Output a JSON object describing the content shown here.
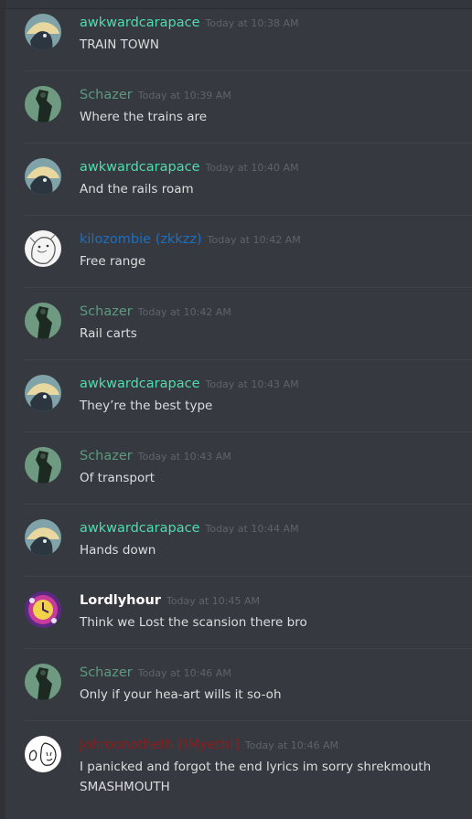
{
  "messages": [
    {
      "author": "awkwardcarapace",
      "timestamp": "Today at 10:38 AM",
      "lines": [
        "TRAIN TOWN"
      ]
    },
    {
      "author": "Schazer",
      "timestamp": "Today at 10:39 AM",
      "lines": [
        "Where the trains are"
      ]
    },
    {
      "author": "awkwardcarapace",
      "timestamp": "Today at 10:40 AM",
      "lines": [
        "And the rails roam"
      ]
    },
    {
      "author": "kilozombie (zkkzz)",
      "timestamp": "Today at 10:42 AM",
      "lines": [
        "Free range"
      ]
    },
    {
      "author": "Schazer",
      "timestamp": "Today at 10:42 AM",
      "lines": [
        "Rail carts"
      ]
    },
    {
      "author": "awkwardcarapace",
      "timestamp": "Today at 10:43 AM",
      "lines": [
        "They’re the best type"
      ]
    },
    {
      "author": "Schazer",
      "timestamp": "Today at 10:43 AM",
      "lines": [
        "Of transport"
      ]
    },
    {
      "author": "awkwardcarapace",
      "timestamp": "Today at 10:44 AM",
      "lines": [
        "Hands down"
      ]
    },
    {
      "author": "Lordlyhour",
      "timestamp": "Today at 10:45 AM",
      "lines": [
        "Think we Lost the scansion there bro"
      ]
    },
    {
      "author": "Schazer",
      "timestamp": "Today at 10:46 AM",
      "lines": [
        "Only if your hea-art wills it so-oh"
      ]
    },
    {
      "author": "Johroonotheth [!Myeth!]",
      "timestamp": "Today at 10:46 AM",
      "lines": [
        "I panicked and forgot the end lyrics im sorry shrekmouth",
        "SMASHMOUTH"
      ]
    }
  ],
  "colors": {
    "background": "#36393f",
    "awkwardcarapace": "#4fdcb0",
    "Schazer": "#5c9a7e",
    "kilozombie": "#1e6fbf",
    "Lordlyhour": "#ffffff",
    "Johroonotheth": "#8e1c1c",
    "timestamp": "#5f636b",
    "message_text": "#dcddde"
  }
}
